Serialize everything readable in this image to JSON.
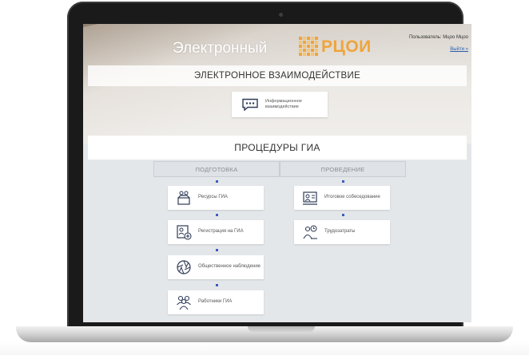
{
  "header": {
    "brand_text": "Электронный",
    "logo_text": "РЦОИ",
    "user_line": "Пользователь: Мцоо Мцоо",
    "logout_label": "Выйти »"
  },
  "sections": {
    "interaction_title": "ЭЛЕКТРОННОЕ ВЗАИМОДЕЙСТВИЕ",
    "procedures_title": "ПРОЦЕДУРЫ ГИА"
  },
  "info_card": {
    "label": "Информационное взаимодействие",
    "icon": "chat-bubble-icon"
  },
  "columns": {
    "preparation": {
      "label": "ПОДГОТОВКА",
      "items": [
        {
          "label": "Ресурсы ГИА",
          "icon": "resources-box-icon"
        },
        {
          "label": "Регистрация на ГИА",
          "icon": "registration-icon"
        },
        {
          "label": "Общественное наблюдение",
          "icon": "aperture-icon"
        },
        {
          "label": "Работники ГИА",
          "icon": "workers-icon"
        }
      ]
    },
    "conduct": {
      "label": "ПРОВЕДЕНИЕ",
      "items": [
        {
          "label": "Итоговое собеседование",
          "icon": "interview-icon"
        },
        {
          "label": "Трудозатраты",
          "icon": "labor-costs-icon"
        }
      ]
    }
  },
  "colors": {
    "accent_orange": "#f0a43a",
    "link_blue": "#2a5db0",
    "connector_blue": "#3b5bbf",
    "screen_bg": "#e4e7ea"
  }
}
